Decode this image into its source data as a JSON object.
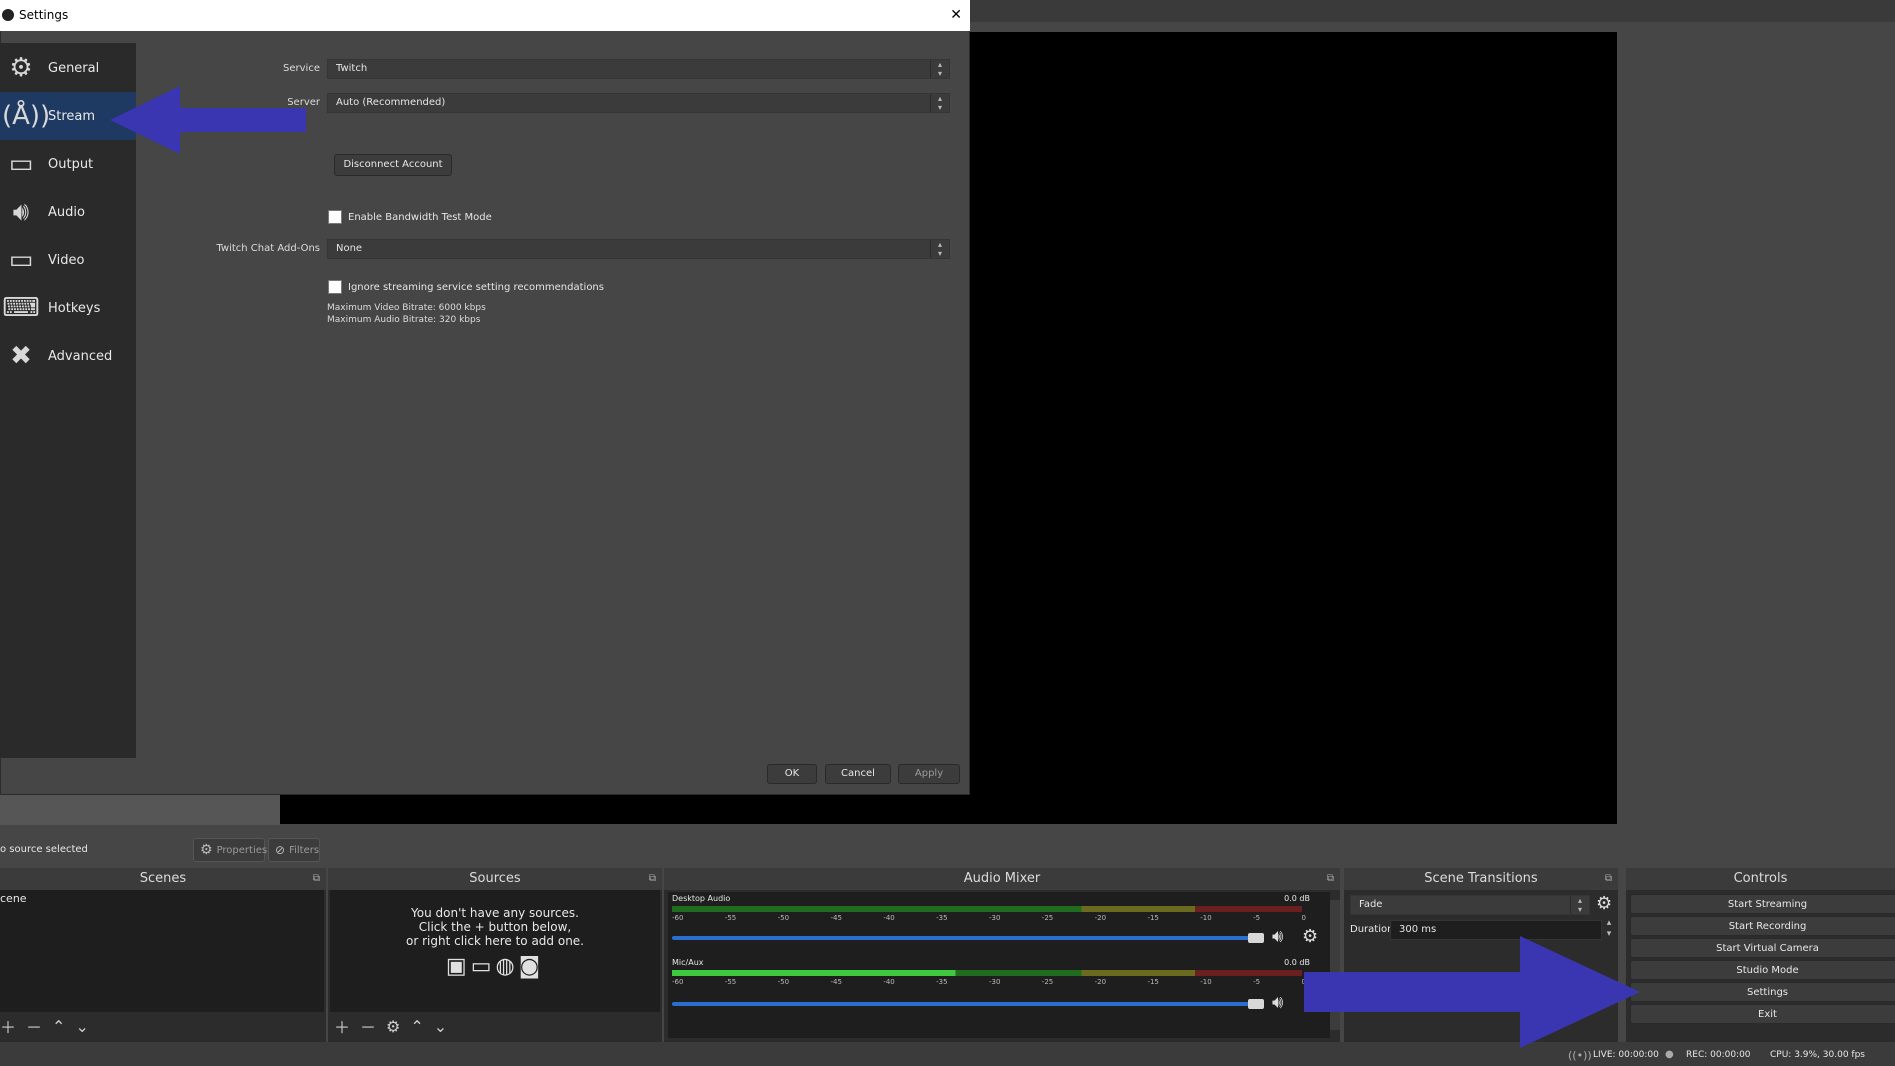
{
  "settings": {
    "title": "Settings",
    "close_glyph": "✕",
    "nav": [
      {
        "label": "General",
        "icon": "gear-icon"
      },
      {
        "label": "Stream",
        "icon": "antenna-icon"
      },
      {
        "label": "Output",
        "icon": "monitor-output-icon"
      },
      {
        "label": "Audio",
        "icon": "speaker-icon"
      },
      {
        "label": "Video",
        "icon": "monitor-icon"
      },
      {
        "label": "Hotkeys",
        "icon": "keyboard-icon"
      },
      {
        "label": "Advanced",
        "icon": "wrench-icon"
      }
    ],
    "active_nav": "Stream",
    "service_label": "Service",
    "service_value": "Twitch",
    "server_label": "Server",
    "server_value": "Auto (Recommended)",
    "disconnect_label": "Disconnect Account",
    "bandwidth_label": "Enable Bandwidth Test Mode",
    "chat_addons_label": "Twitch Chat Add-Ons",
    "chat_addons_value": "None",
    "ignore_label": "Ignore streaming service setting recommendations",
    "max_video": "Maximum Video Bitrate: 6000 kbps",
    "max_audio": "Maximum Audio Bitrate: 320 kbps",
    "ok_label": "OK",
    "cancel_label": "Cancel",
    "apply_label": "Apply"
  },
  "main": {
    "no_source": "o source selected",
    "properties_label": "Properties",
    "filters_label": "Filters",
    "scenes": {
      "title": "Scenes",
      "items": [
        "cene"
      ]
    },
    "sources": {
      "title": "Sources",
      "empty_line1": "You don't have any sources.",
      "empty_line2": "Click the + button below,",
      "empty_line3": "or right click here to add one."
    },
    "mixer": {
      "title": "Audio Mixer",
      "channels": [
        {
          "name": "Desktop Audio",
          "db": "0.0 dB"
        },
        {
          "name": "Mic/Aux",
          "db": "0.0 dB"
        }
      ],
      "ticks": [
        "-60",
        "-55",
        "-50",
        "-45",
        "-40",
        "-35",
        "-30",
        "-25",
        "-20",
        "-15",
        "-10",
        "-5",
        "0"
      ]
    },
    "transitions": {
      "title": "Scene Transitions",
      "value": "Fade",
      "duration_label": "Duration",
      "duration_value": "300 ms"
    },
    "controls": {
      "title": "Controls",
      "buttons": [
        "Start Streaming",
        "Start Recording",
        "Start Virtual Camera",
        "Studio Mode",
        "Settings",
        "Exit"
      ]
    },
    "status": {
      "live": "LIVE: 00:00:00",
      "rec": "REC: 00:00:00",
      "cpu": "CPU: 3.9%, 30.00 fps"
    }
  },
  "colors": {
    "arrow": "#3a35b0",
    "accent_nav": "#1e3a62"
  }
}
